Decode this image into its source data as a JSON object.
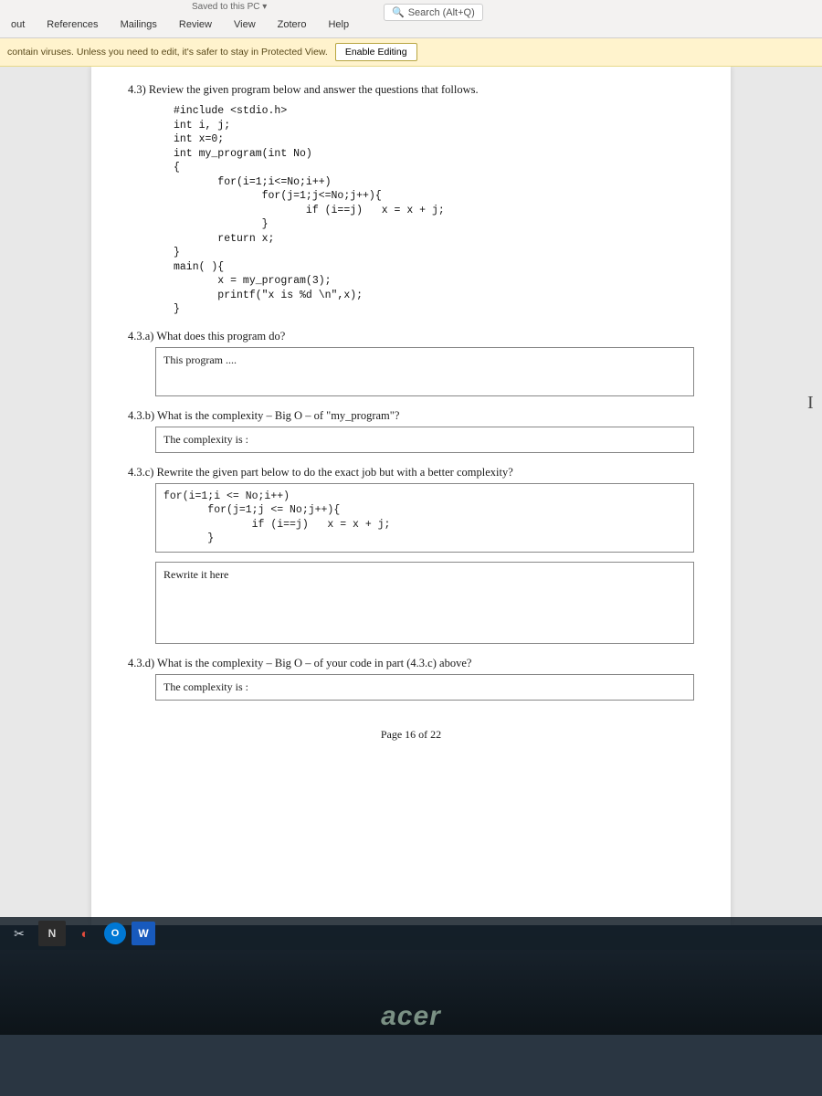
{
  "titleFragment": "Saved to this PC ▾",
  "search": {
    "placeholder": "Search (Alt+Q)"
  },
  "ribbonTabs": [
    "out",
    "References",
    "Mailings",
    "Review",
    "View",
    "Zotero",
    "Help"
  ],
  "protectedView": {
    "msg": "contain viruses. Unless you need to edit, it's safer to stay in Protected View.",
    "button": "Enable Editing"
  },
  "doc": {
    "q43": "4.3)  Review the given program below and answer the questions that follows.",
    "code": "#include <stdio.h>\nint i, j;\nint x=0;\nint my_program(int No)\n{\n       for(i=1;i<=No;i++)\n              for(j=1;j<=No;j++){\n                     if (i==j)   x = x + j;\n              }\n       return x;\n}\nmain( ){\n       x = my_program(3);\n       printf(\"x is %d \\n\",x);\n}",
    "q43a": "4.3.a) What does this program do?",
    "ans_a": "This program ....",
    "q43b": "4.3.b) What is the complexity – Big O – of \"my_program\"?",
    "ans_b": "The complexity is :",
    "q43c": "4.3.c) Rewrite the given part below to do the exact job but with a better complexity?",
    "code_c": "for(i=1;i <= No;i++)\n       for(j=1;j <= No;j++){\n              if (i==j)   x = x + j;\n       }",
    "ans_c": "Rewrite it here",
    "q43d": "4.3.d) What is the complexity – Big O – of your code in part (4.3.c) above?",
    "ans_d": "The complexity is :",
    "pageNum": "Page 16 of 22"
  },
  "brand": "acer",
  "taskbar": {
    "n": "N",
    "o": "O",
    "w": "W"
  }
}
